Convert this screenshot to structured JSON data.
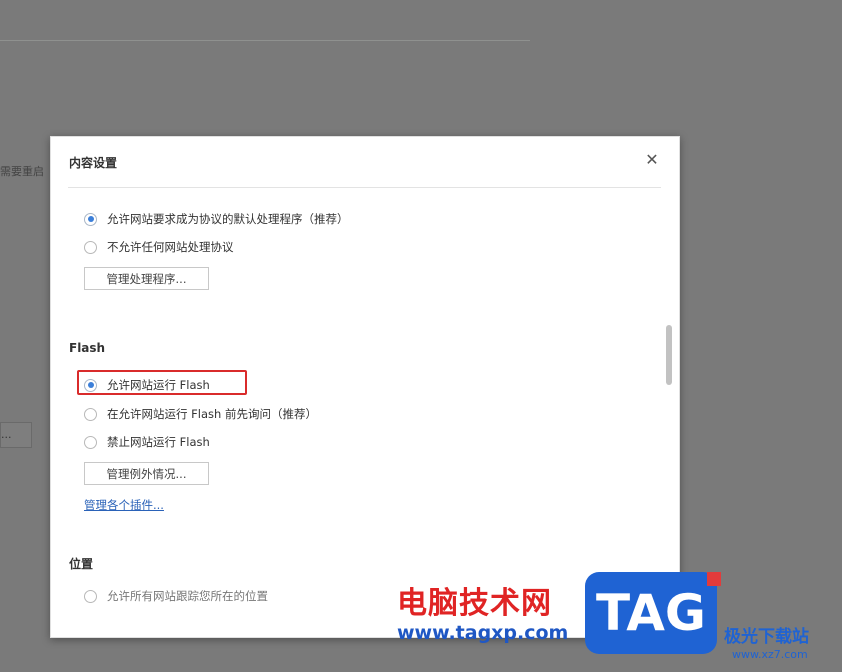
{
  "background": {
    "partial_text": "需要重启",
    "partial_button_label": "..."
  },
  "dialog": {
    "title": "内容设置",
    "close_icon": "close-icon",
    "protocol_section": {
      "options": [
        {
          "label": "允许网站要求成为协议的默认处理程序（推荐）",
          "checked": true
        },
        {
          "label": "不允许任何网站处理协议",
          "checked": false
        }
      ],
      "manage_button": "管理处理程序..."
    },
    "flash_section": {
      "title": "Flash",
      "options": [
        {
          "label": "允许网站运行 Flash",
          "checked": true
        },
        {
          "label": "在允许网站运行 Flash 前先询问（推荐）",
          "checked": false
        },
        {
          "label": "禁止网站运行 Flash",
          "checked": false
        }
      ],
      "manage_button": "管理例外情况...",
      "plugins_link": "管理各个插件..."
    },
    "location_section": {
      "title": "位置",
      "partial_option": "允许所有网站跟踪您所在的位置"
    }
  },
  "watermark": {
    "site_name": "电脑技术网",
    "site_url": "www.tagxp.com",
    "logo_text": "TAG",
    "brand_name": "极光下载站",
    "brand_url": "www.xz7.com"
  },
  "colors": {
    "accent": "#3b7fd9",
    "highlight_border": "#d92b2b",
    "link": "#2a62b8"
  }
}
